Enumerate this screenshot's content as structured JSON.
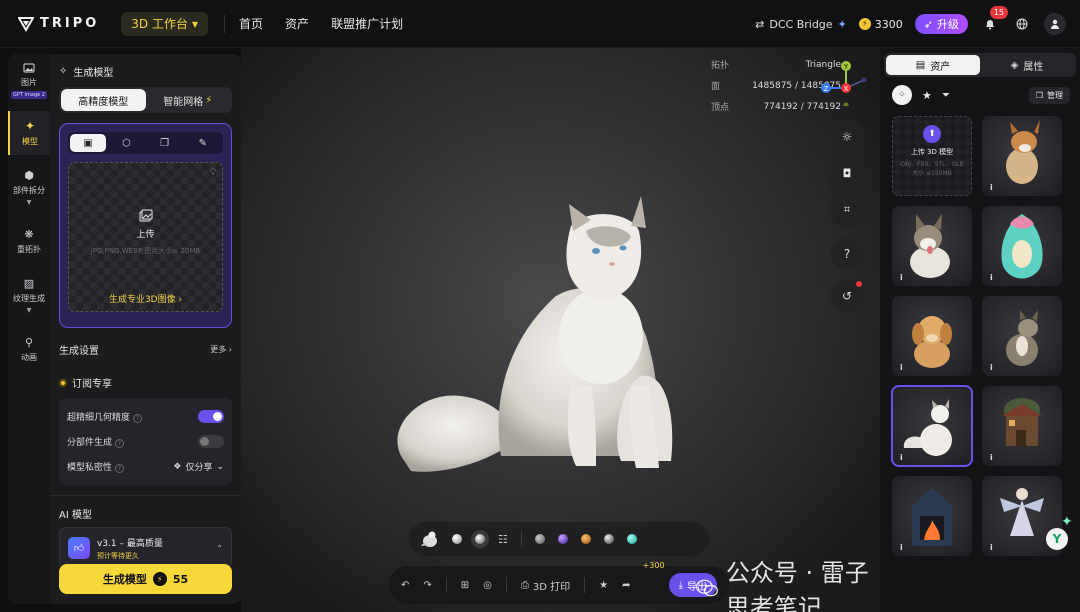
{
  "topbar": {
    "brand": "TRIPO",
    "workspace": "3D 工作台",
    "nav": [
      "首页",
      "资产",
      "联盟推广计划"
    ],
    "dcc": "DCC Bridge",
    "credits": "3300",
    "upgrade": "升级",
    "notifications": "15"
  },
  "rail": {
    "items": [
      {
        "label": "图片",
        "tag": "GPT Image 2"
      },
      {
        "label": "模型"
      },
      {
        "label": "部件拆分"
      },
      {
        "label": "重拓扑"
      },
      {
        "label": "纹理生成"
      },
      {
        "label": "动画"
      }
    ]
  },
  "panel": {
    "title": "生成模型",
    "modes": [
      "高精度模型",
      "智能网格"
    ],
    "upload_label": "上传",
    "upload_hint": "JPG,PNG,WEBP 图片大小≤ 20MB",
    "upload_link": "生成专业3D图像 ›",
    "settings": "生成设置",
    "more": "更多 ›",
    "vip_title": "订阅专享",
    "options": {
      "ultra": "超精细几何精度",
      "parts": "分部件生成",
      "privacy": "模型私密性",
      "privacy_value": "仅分享"
    },
    "ai_title": "AI 模型",
    "model_name": "v3.1 – 最高质量",
    "model_sub": "预计等待更久",
    "generate": "生成模型",
    "generate_cost": "55"
  },
  "stats": {
    "topology_label": "拓扑",
    "topology_value": "Triangle",
    "faces_label": "面",
    "faces_value": "1485875 / 1485875",
    "verts_label": "顶点",
    "verts_value": "774192 / 774192"
  },
  "gizmo": {
    "y": "Y",
    "z": "Z",
    "x": "X"
  },
  "bottombar": {
    "print": "3D 打印",
    "export": "导出",
    "bonus": "+300"
  },
  "watermark": "公众号 · 雷子思考笔记",
  "right": {
    "tabs": [
      "资产",
      "属性"
    ],
    "manage": "管理",
    "upload_title": "上传 3D 模型",
    "upload_hint": "OBJ、FBX、STL、GLB 大小 ≤150MB",
    "info": "i"
  },
  "colors": {
    "accent": "#f7d83b",
    "purple": "#6a4fe8"
  }
}
